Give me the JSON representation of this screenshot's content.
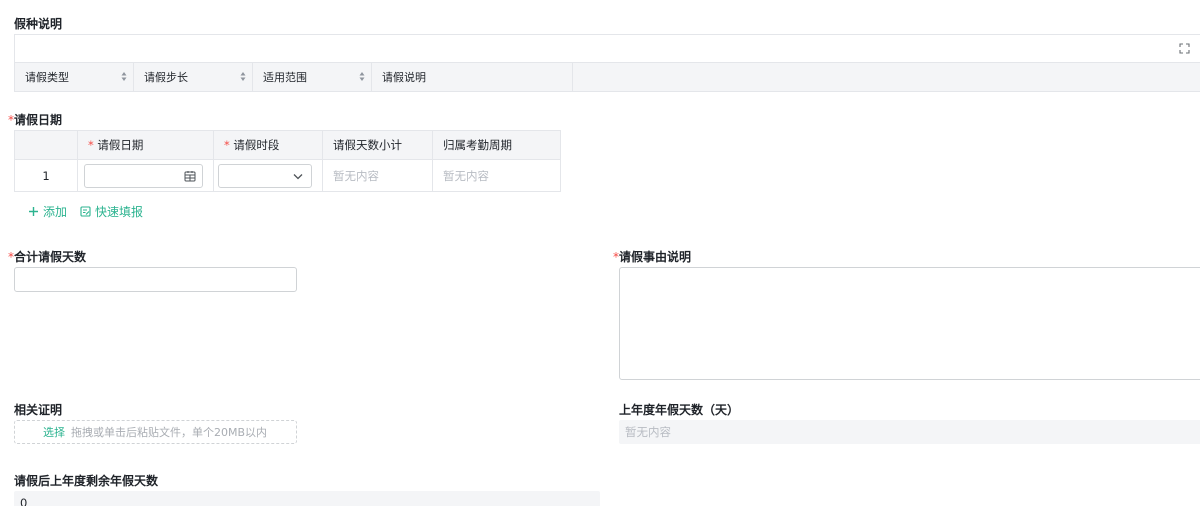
{
  "leave_types": {
    "title": "假种说明",
    "columns": [
      "请假类型",
      "请假步长",
      "适用范围",
      "请假说明"
    ]
  },
  "leave_dates": {
    "title": "请假日期",
    "required_mark": "*",
    "columns": [
      "",
      "请假日期",
      "请假时段",
      "请假天数小计",
      "归属考勤周期"
    ],
    "rows": [
      {
        "index": "1",
        "date": "",
        "period": "",
        "days_subtotal": "暂无内容",
        "cycle": "暂无内容"
      }
    ],
    "add_label": "添加",
    "quick_fill_label": "快速填报"
  },
  "total_days": {
    "label": "合计请假天数",
    "value": ""
  },
  "reason": {
    "label": "请假事由说明",
    "value": ""
  },
  "attachment": {
    "label": "相关证明",
    "select_label": "选择",
    "hint": "拖拽或单击后粘贴文件，单个20MB以内"
  },
  "prev_annual": {
    "label": "上年度年假天数（天）",
    "value": "暂无内容"
  },
  "remaining": {
    "label": "请假后上年度剩余年假天数",
    "value": "0"
  },
  "colors": {
    "accent": "#2bb38f",
    "required": "#f54a45",
    "header_bg": "#f4f5f7",
    "border": "#e4e6ea"
  }
}
